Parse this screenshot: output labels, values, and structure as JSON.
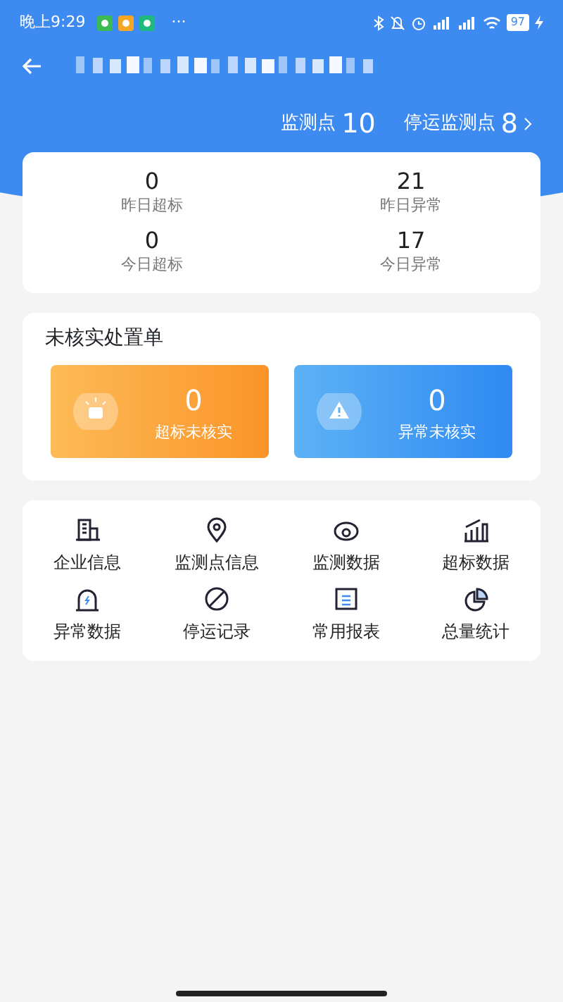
{
  "status_bar": {
    "time": "晚上9:29",
    "more": "···",
    "battery": "97"
  },
  "summary": {
    "points_label": "监测点",
    "points": "10",
    "stopped_label": "停运监测点",
    "stopped": "8"
  },
  "stats": [
    {
      "value": "0",
      "label": "昨日超标"
    },
    {
      "value": "21",
      "label": "昨日异常"
    },
    {
      "value": "0",
      "label": "今日超标"
    },
    {
      "value": "17",
      "label": "今日异常"
    }
  ],
  "pending": {
    "title": "未核实处置单",
    "items": [
      {
        "kind": "exceed",
        "value": "0",
        "label": "超标未核实"
      },
      {
        "kind": "abnormal",
        "value": "0",
        "label": "异常未核实"
      }
    ]
  },
  "menu": [
    {
      "kind": "building",
      "label": "企业信息"
    },
    {
      "kind": "pin",
      "label": "监测点信息"
    },
    {
      "kind": "eye",
      "label": "监测数据"
    },
    {
      "kind": "bars",
      "label": "超标数据"
    },
    {
      "kind": "alarm",
      "label": "异常数据"
    },
    {
      "kind": "stop",
      "label": "停运记录"
    },
    {
      "kind": "report",
      "label": "常用报表"
    },
    {
      "kind": "pie",
      "label": "总量统计"
    }
  ]
}
